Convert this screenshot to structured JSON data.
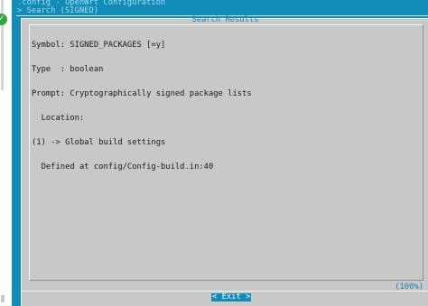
{
  "terminal": {
    "title_line1": ".config - OpenWrt Configuration",
    "title_line2": "> Search (SIGNED)"
  },
  "dialog": {
    "title": "Search Results",
    "lines": [
      "Symbol: SIGNED_PACKAGES [=y]",
      "Type  : boolean",
      "Prompt: Cryptographically signed package lists",
      "  Location:",
      "(1) -> Global build settings",
      "  Defined at config/Config-build.in:40"
    ],
    "percent": "(100%)",
    "exit_button": "< Exit >"
  },
  "colors": {
    "terminal_bg": "#0f8cb8",
    "dialog_bg": "#c8c8c8",
    "accent_text": "#1f7fb0",
    "status_green": "#2fa93b"
  },
  "icons": {
    "left_status": "check-icon"
  }
}
